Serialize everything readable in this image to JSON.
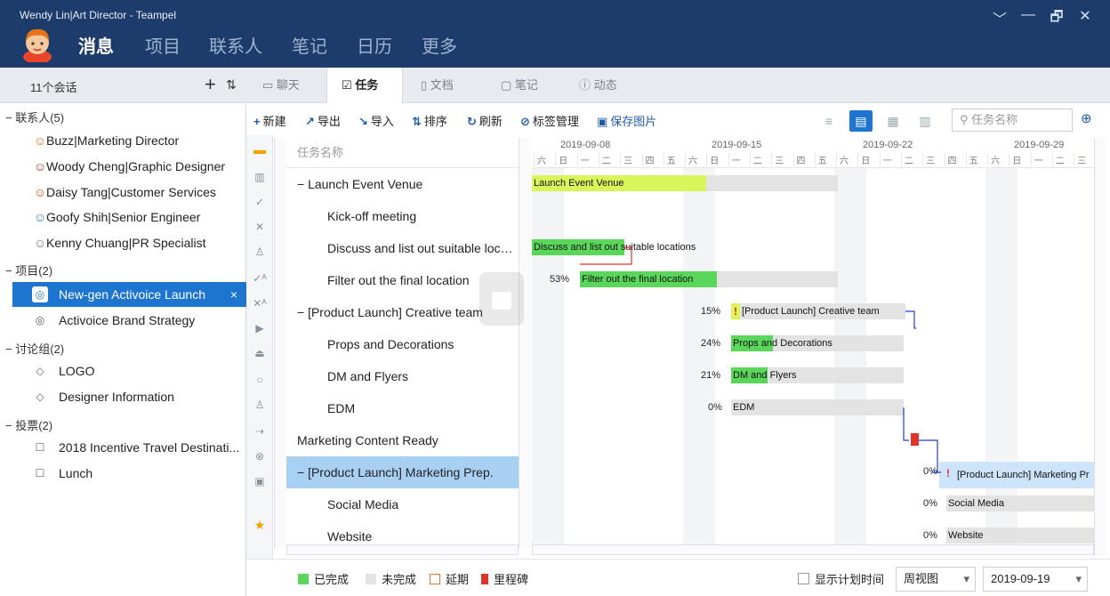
{
  "window": {
    "title": "Wendy Lin|Art Director - Teampel",
    "controls": [
      "﹀",
      "—",
      "🗗",
      "✕"
    ]
  },
  "nav": {
    "items": [
      "消息",
      "项目",
      "联系人",
      "笔记",
      "日历",
      "更多"
    ],
    "active": 0
  },
  "left": {
    "conv_count": "11个会话",
    "add": "+",
    "sort": "⇅",
    "groups": [
      {
        "label": "− 联系人(5)",
        "items": [
          "Buzz|Marketing Director",
          "Woody Cheng|Graphic Designer",
          "Daisy Tang|Customer Services",
          "Goofy Shih|Senior Engineer",
          "Kenny Chuang|PR Specialist"
        ]
      },
      {
        "label": "− 项目(2)",
        "items": [
          "New-gen Activoice Launch",
          "Activoice Brand Strategy"
        ]
      },
      {
        "label": "− 讨论组(2)",
        "items": [
          "LOGO",
          "Designer Information"
        ]
      },
      {
        "label": "− 投票(2)",
        "items": [
          "2018 Incentive Travel Destinati...",
          "Lunch"
        ]
      }
    ]
  },
  "tabs": [
    "聊天",
    "任务",
    "文档",
    "笔记",
    "动态"
  ],
  "toolbar": {
    "new": "新建",
    "export": "导出",
    "import": "导入",
    "sort": "排序",
    "refresh": "刷新",
    "tags": "标签管理",
    "save_img": "保存图片",
    "search_placeholder": "任务名称"
  },
  "tasklist": {
    "header": "任务名称",
    "rows": [
      "− Launch Event Venue",
      "Kick-off meeting",
      "Discuss and list out suitable locati...",
      "Filter out the final location",
      "− [Product Launch] Creative team",
      "Props and Decorations",
      "DM and Flyers",
      "EDM",
      "Marketing Content Ready",
      "− [Product Launch] Marketing Prep.",
      "Social Media",
      "Website"
    ]
  },
  "gantt": {
    "weeks": [
      "2019-09-08",
      "2019-09-15",
      "2019-09-22",
      "2019-09-29"
    ],
    "days": [
      "六",
      "日",
      "一",
      "二",
      "三",
      "四",
      "五"
    ],
    "bars": {
      "b0": "Launch Event Venue",
      "b2": "Discuss and list out suitable locations",
      "b3": "Filter out the final location",
      "b4": "[Product Launch] Creative team",
      "b5": "Props and Decorations",
      "b6": "DM and Flyers",
      "b7": "EDM",
      "b9": "[Product Launch] Marketing Pr",
      "b10": "Social Media",
      "b11": "Website"
    },
    "pcts": {
      "p3": "53%",
      "p4": "15%",
      "p5": "24%",
      "p6": "21%",
      "p7": "0%",
      "p9": "0%",
      "p10": "0%",
      "p11": "0%"
    },
    "flag": "!"
  },
  "legend": {
    "done": "已完成",
    "undone": "未完成",
    "delay": "延期",
    "milestone": "里程碑",
    "show_plan": "显示计划时间",
    "view": "周视图",
    "date": "2019-09-19"
  },
  "colors": {
    "title": "#1d3c6b",
    "accent": "#1e75d0",
    "done": "#5ad65a",
    "partial": "#d8f55a",
    "undone": "#e3e3e3",
    "milestone": "#e0332a",
    "selrow": "#a8d0f3"
  }
}
